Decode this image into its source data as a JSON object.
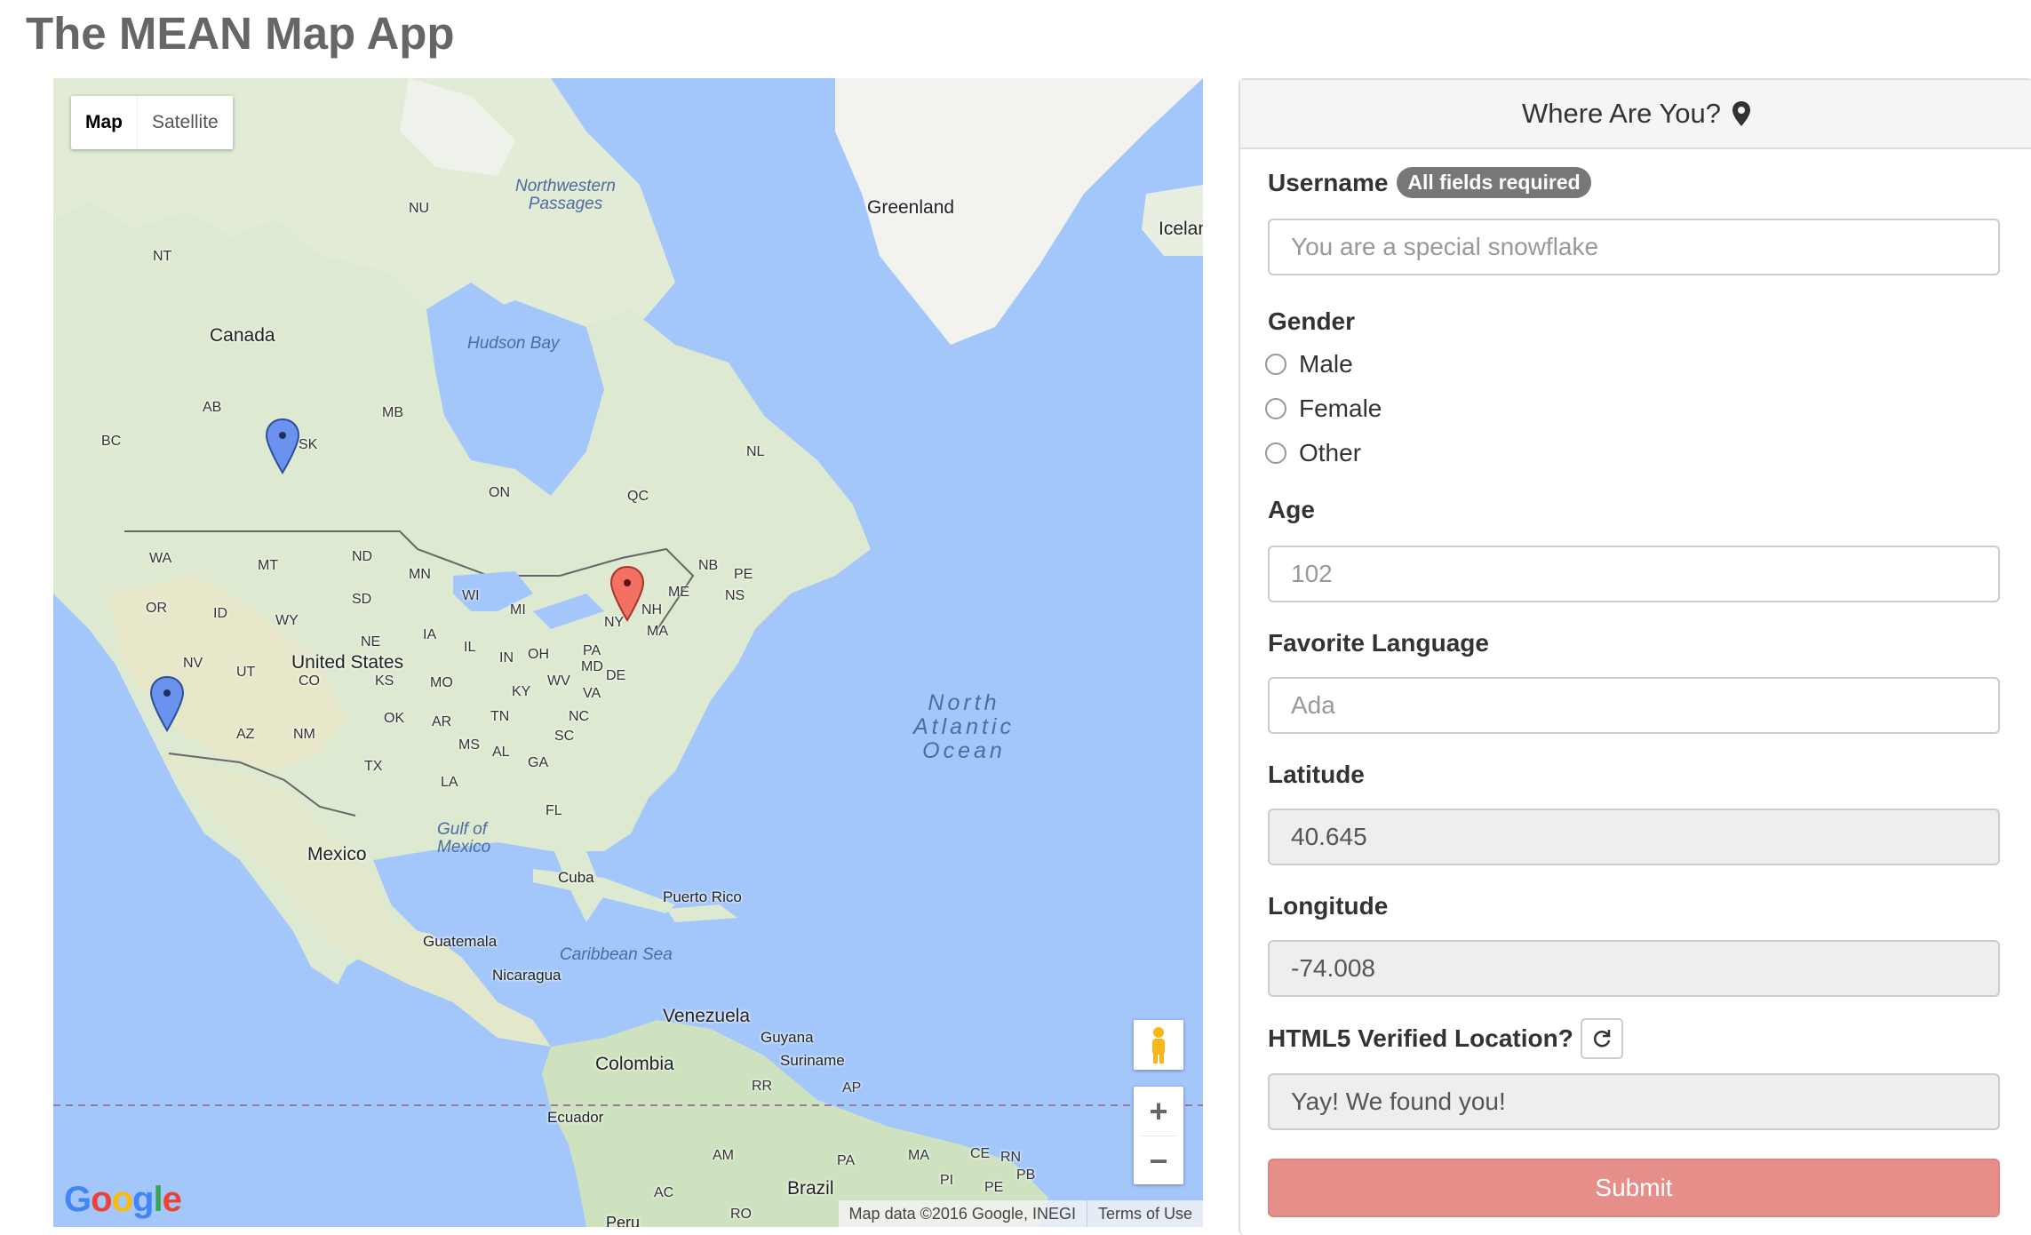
{
  "app_title": "The MEAN Map App",
  "map": {
    "type_controls": [
      "Map",
      "Satellite"
    ],
    "active_type": "Map",
    "labels": {
      "countries": [
        "Canada",
        "United States",
        "Mexico",
        "Greenland",
        "Icelan",
        "Cuba",
        "Puerto Rico",
        "Guatemala",
        "Nicaragua",
        "Venezuela",
        "Guyana",
        "Suriname",
        "Colombia",
        "Ecuador",
        "Brazil",
        "Peru"
      ],
      "regions": [
        "NU",
        "NT",
        "AB",
        "BC",
        "SK",
        "MB",
        "ON",
        "QC",
        "NL",
        "NB",
        "PE",
        "NS",
        "ME",
        "NH",
        "NY",
        "MA",
        "PA",
        "MD",
        "DE",
        "WA",
        "MT",
        "ND",
        "MN",
        "WI",
        "MI",
        "OR",
        "ID",
        "WY",
        "SD",
        "NE",
        "IA",
        "IL",
        "IN",
        "OH",
        "WV",
        "VA",
        "NV",
        "UT",
        "CO",
        "KS",
        "MO",
        "KY",
        "NC",
        "TN",
        "OK",
        "AR",
        "SC",
        "AZ",
        "NM",
        "TX",
        "MS",
        "AL",
        "GA",
        "LA",
        "FL",
        "RR",
        "AP",
        "AM",
        "PA",
        "MA",
        "CE",
        "RN",
        "PB",
        "PI",
        "PE",
        "AC",
        "RO"
      ],
      "water": [
        "Northwestern Passages",
        "Hudson Bay",
        "Gulf of Mexico",
        "Caribbean Sea"
      ],
      "ocean": "North Atlantic Ocean"
    },
    "markers": [
      {
        "color": "blue",
        "place": "Saskatchewan"
      },
      {
        "color": "blue",
        "place": "California"
      },
      {
        "color": "red",
        "place": "New York"
      }
    ],
    "zoom_in": "+",
    "zoom_out": "−",
    "logo": "Google",
    "attribution": "Map data ©2016 Google, INEGI",
    "terms": "Terms of Use"
  },
  "form": {
    "heading": "Where Are You?",
    "username_label": "Username",
    "required_badge": "All fields required",
    "username_placeholder": "You are a special snowflake",
    "gender_label": "Gender",
    "gender_options": [
      "Male",
      "Female",
      "Other"
    ],
    "age_label": "Age",
    "age_placeholder": "102",
    "language_label": "Favorite Language",
    "language_placeholder": "Ada",
    "latitude_label": "Latitude",
    "latitude_value": "40.645",
    "longitude_label": "Longitude",
    "longitude_value": "-74.008",
    "verified_label": "HTML5 Verified Location?",
    "verified_value": "Yay! We found you!",
    "submit_label": "Submit"
  },
  "colors": {
    "submit_bg": "#e58e8a",
    "badge_bg": "#777777",
    "water": "#a3c7fb",
    "land": "#dde9d0"
  }
}
